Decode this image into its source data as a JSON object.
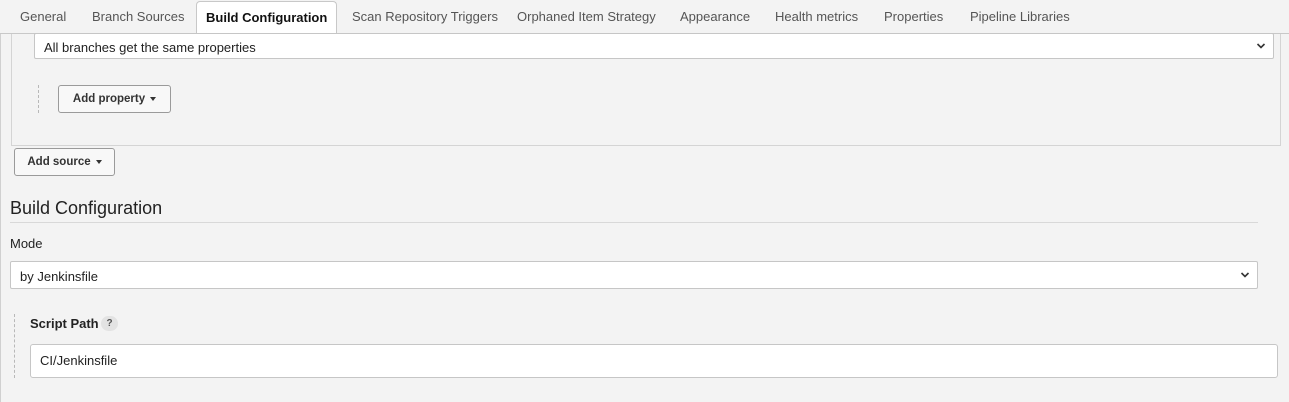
{
  "tabs": [
    {
      "label": "General",
      "active": false
    },
    {
      "label": "Branch Sources",
      "active": false
    },
    {
      "label": "Build Configuration",
      "active": true
    },
    {
      "label": "Scan Repository Triggers",
      "active": false
    },
    {
      "label": "Orphaned Item Strategy",
      "active": false
    },
    {
      "label": "Appearance",
      "active": false
    },
    {
      "label": "Health metrics",
      "active": false
    },
    {
      "label": "Properties",
      "active": false
    },
    {
      "label": "Pipeline Libraries",
      "active": false
    }
  ],
  "branch_source": {
    "property_strategy_value": "All branches get the same properties",
    "add_property_label": "Add property",
    "add_source_label": "Add source"
  },
  "build_configuration": {
    "title": "Build Configuration",
    "mode_label": "Mode",
    "mode_value": "by Jenkinsfile",
    "script_path_label": "Script Path",
    "help_label": "?",
    "script_path_value": "CI/Jenkinsfile"
  },
  "icons": {
    "dropdown": "chevron-down-icon",
    "caret": "caret-down-icon",
    "help": "help-icon"
  }
}
